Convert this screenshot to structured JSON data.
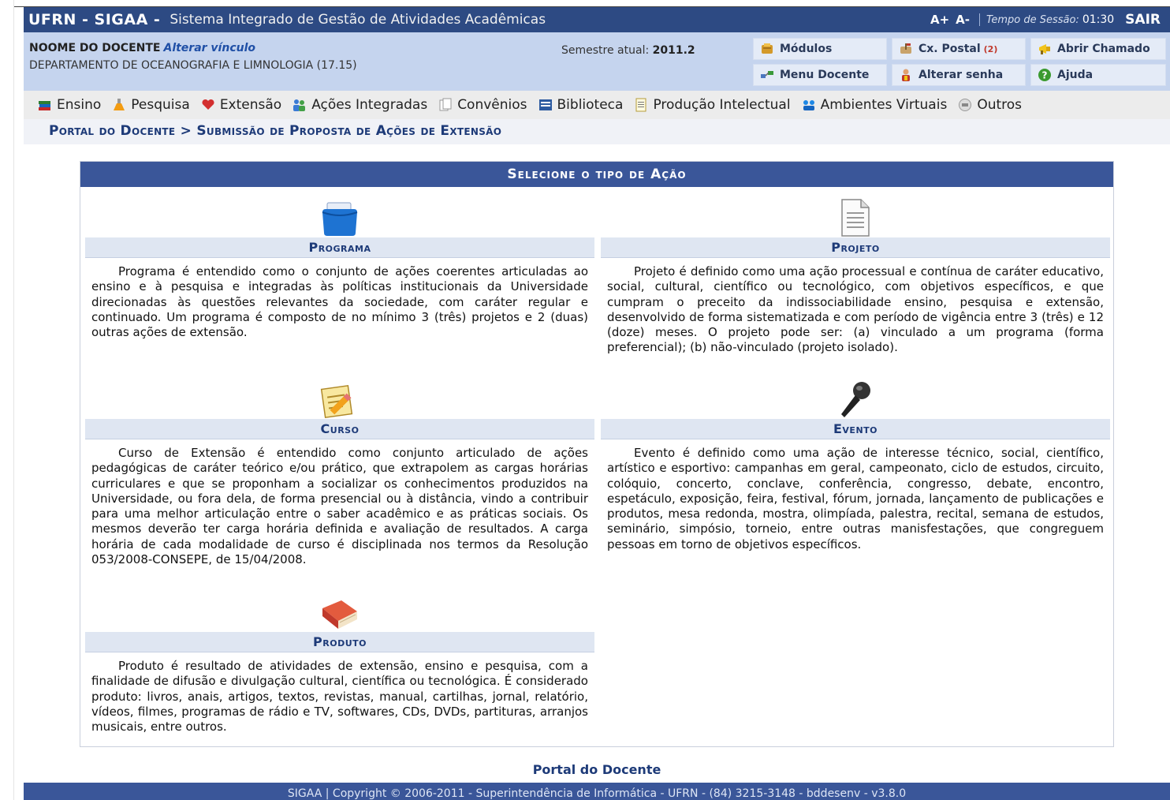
{
  "header": {
    "brand": "UFRN - SIGAA -",
    "subtitle": "Sistema Integrado de Gestão de Atividades Acadêmicas",
    "font_increase": "A+",
    "font_decrease": "A-",
    "session_label": "Tempo de Sessão:",
    "session_time": "01:30",
    "logout": "SAIR"
  },
  "user": {
    "name": "NOOME DO DOCENTE",
    "change_link": "Alterar vínculo",
    "department": "DEPARTAMENTO DE OCEANOGRAFIA E LIMNOLOGIA (17.15)",
    "semester_label": "Semestre atual:",
    "semester_value": "2011.2"
  },
  "quick_buttons": {
    "modulos": "Módulos",
    "cx_postal": "Cx. Postal",
    "cx_postal_count": "(2)",
    "abrir_chamado": "Abrir Chamado",
    "menu_docente": "Menu Docente",
    "alterar_senha": "Alterar senha",
    "ajuda": "Ajuda"
  },
  "menu": {
    "ensino": "Ensino",
    "pesquisa": "Pesquisa",
    "extensao": "Extensão",
    "acoes_integradas": "Ações Integradas",
    "convenios": "Convênios",
    "biblioteca": "Biblioteca",
    "producao": "Produção Intelectual",
    "ambientes": "Ambientes Virtuais",
    "outros": "Outros"
  },
  "breadcrumb": "Portal do Docente > Submissão de Proposta de Ações de Extensão",
  "panel_title": "Selecione o tipo de Ação",
  "actions": {
    "programa": {
      "title": "Programa",
      "text": "Programa é entendido como o conjunto de ações coerentes articuladas ao ensino e à pesquisa e integradas às políticas institucionais da Universidade direcionadas às questões relevantes da sociedade, com caráter regular e continuado. Um programa é composto de no mínimo 3 (três) projetos e 2 (duas) outras ações de extensão."
    },
    "projeto": {
      "title": "Projeto",
      "text": "Projeto é definido como uma ação processual e contínua de caráter educativo, social, cultural, científico ou tecnológico, com objetivos específicos, e que cumpram o preceito da indissociabilidade ensino, pesquisa e extensão, desenvolvido de forma sistematizada e com período de vigência entre 3 (três) e 12 (doze) meses. O projeto pode ser: (a) vinculado a um programa (forma preferencial); (b) não-vinculado (projeto isolado)."
    },
    "curso": {
      "title": "Curso",
      "text": "Curso de Extensão é entendido como conjunto articulado de ações pedagógicas de caráter teórico e/ou prático, que extrapolem as cargas horárias curriculares e que se proponham a socializar os conhecimentos produzidos na Universidade, ou fora dela, de forma presencial ou à distância, vindo a contribuir para uma melhor articulação entre o saber acadêmico e as práticas sociais. Os mesmos deverão ter carga horária definida e avaliação de resultados. A carga horária de cada modalidade de curso é disciplinada nos termos da Resolução 053/2008-CONSEPE, de 15/04/2008."
    },
    "evento": {
      "title": "Evento",
      "text": "Evento é definido como uma ação de interesse técnico, social, científico, artístico e esportivo: campanhas em geral, campeonato, ciclo de estudos, circuito, colóquio, concerto, conclave, conferência, congresso, debate, encontro, espetáculo, exposição, feira, festival, fórum, jornada, lançamento de publicações e produtos, mesa redonda, mostra, olimpíada, palestra, recital, semana de estudos, seminário, simpósio, torneio, entre outras manisfestações, que congreguem pessoas em torno de objetivos específicos."
    },
    "produto": {
      "title": "Produto",
      "text": "Produto é resultado de atividades de extensão, ensino e pesquisa, com a finalidade de difusão e divulgação cultural, científica ou tecnológica. É considerado produto: livros, anais, artigos, textos, revistas, manual, cartilhas, jornal, relatório, vídeos, filmes, programas de rádio e TV, softwares, CDs, DVDs, partituras, arranjos musicais, entre outros."
    }
  },
  "footer_link": "Portal do Docente",
  "footer": "SIGAA | Copyright © 2006-2011 - Superintendência de Informática - UFRN - (84) 3215-3148 - bddesenv - v3.8.0"
}
